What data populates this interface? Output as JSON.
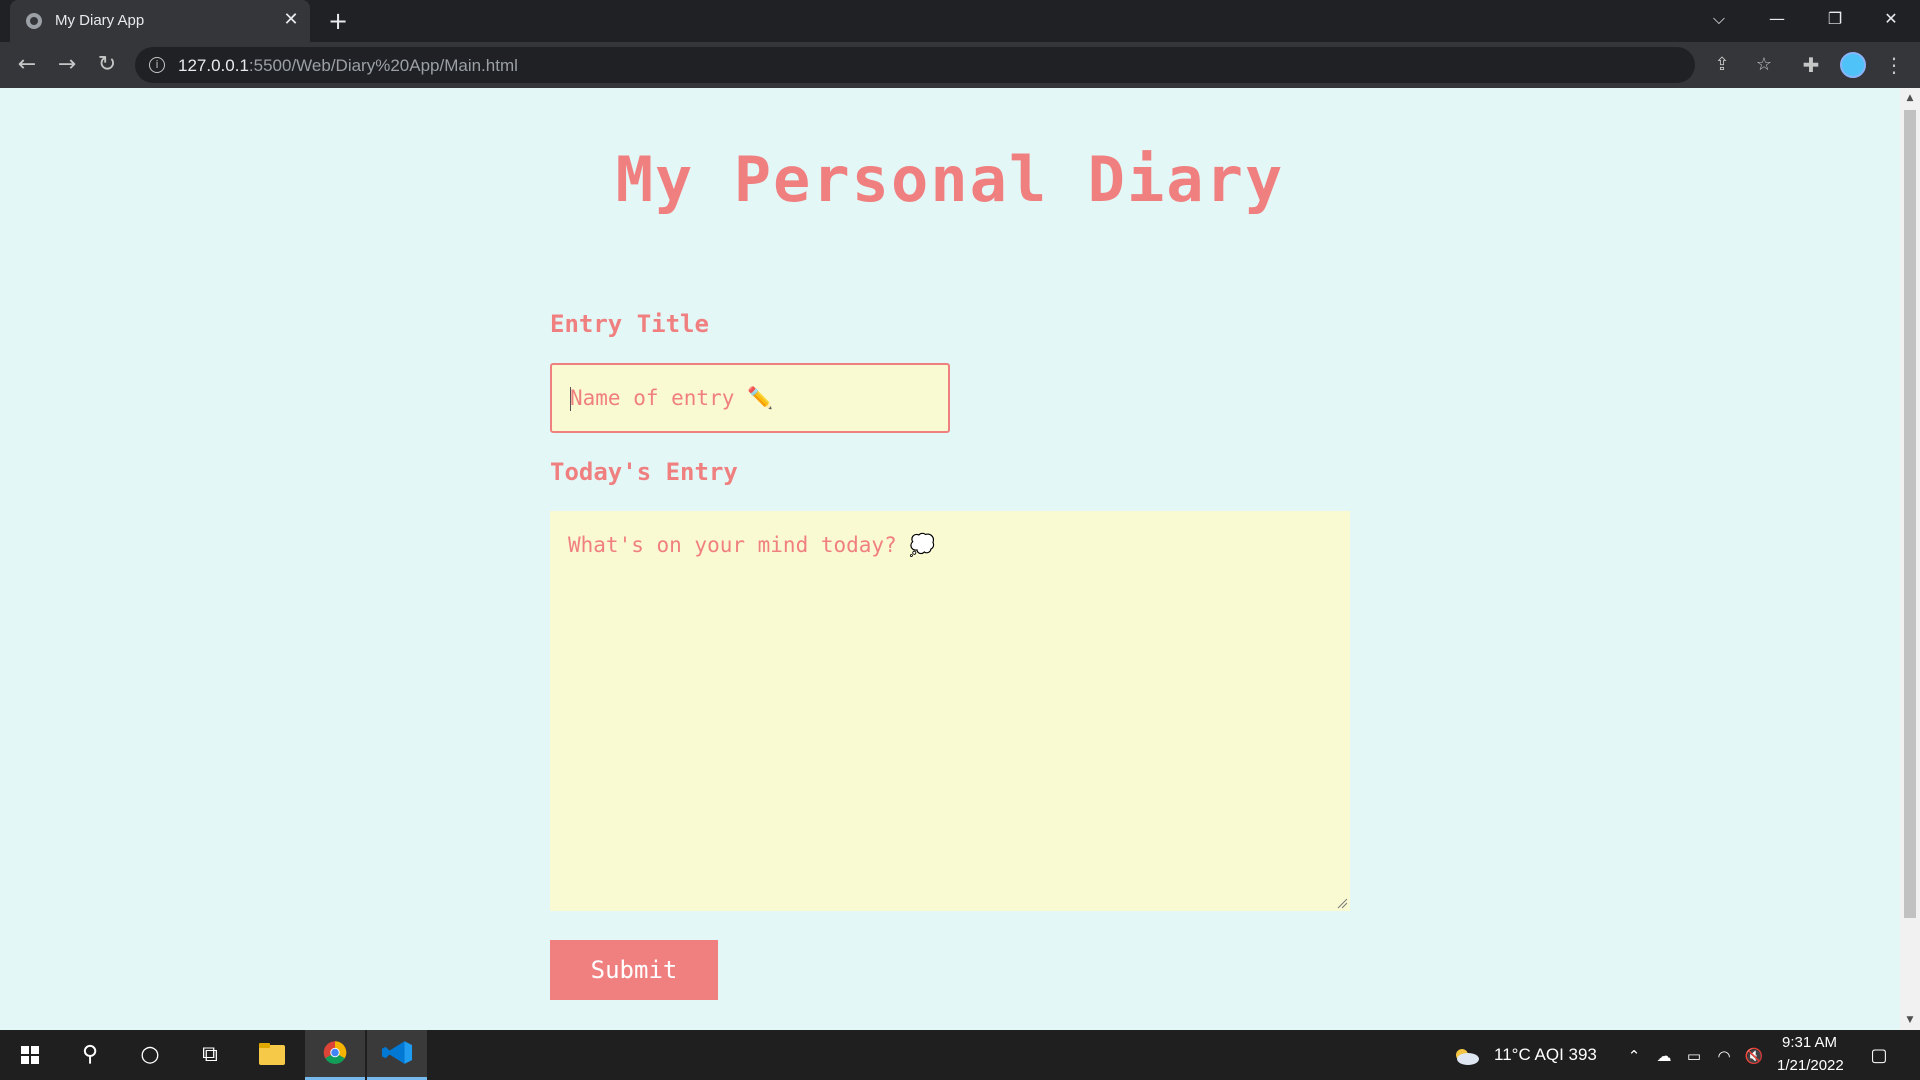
{
  "browser": {
    "tab_title": "My Diary App",
    "tab_close": "✕",
    "new_tab": "+",
    "url_host": "127.0.0.1",
    "url_rest": ":5500/Web/Diary%20App/Main.html",
    "window_controls": {
      "dropdown": "⌵",
      "minimize": "—",
      "restore": "❐",
      "close": "✕"
    },
    "nav": {
      "back": "←",
      "forward": "→",
      "reload": "↻"
    }
  },
  "page": {
    "heading": "My Personal Diary",
    "entry_title_label": "Entry Title",
    "entry_title_placeholder": "Name of entry ✏️",
    "todays_entry_label": "Today's Entry",
    "todays_entry_placeholder": "What's on your mind today? 💭",
    "submit_label": "Submit"
  },
  "taskbar": {
    "weather": "11°C  AQI 393",
    "time": "9:31 AM",
    "date": "1/21/2022"
  },
  "colors": {
    "accent": "#f08080",
    "page_bg": "#e3f7f7",
    "field_bg": "#fafad2",
    "chrome_dark": "#202124",
    "chrome_mid": "#35363a",
    "taskbar_bg": "#1f1f1f"
  },
  "icons": [
    "globe-icon",
    "info-icon",
    "share-icon",
    "star-icon",
    "puzzle-icon",
    "kebab-menu-icon",
    "windows-start-icon",
    "search-icon",
    "cortana-icon",
    "task-view-icon",
    "file-explorer-icon",
    "chrome-icon",
    "vscode-icon",
    "cloud-weather-icon",
    "chevron-up-icon",
    "onedrive-icon",
    "battery-icon",
    "wifi-icon",
    "volume-muted-icon",
    "notification-icon"
  ]
}
